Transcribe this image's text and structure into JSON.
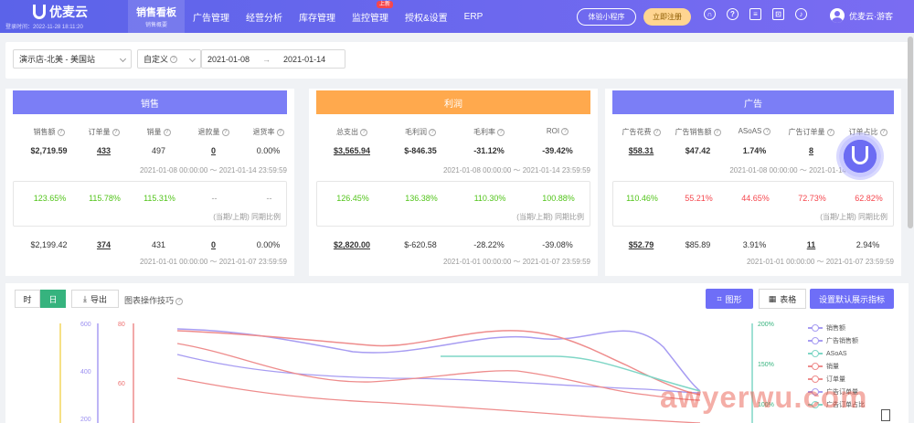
{
  "app": {
    "brand": "优麦云",
    "login_time": "登录时间：2022-11-28 18:11:20"
  },
  "nav": [
    {
      "label": "销售看板",
      "sub": "销售概要",
      "active": true
    },
    {
      "label": "广告管理"
    },
    {
      "label": "经营分析"
    },
    {
      "label": "库存管理"
    },
    {
      "label": "监控管理",
      "badge": "上新"
    },
    {
      "label": "授权&设置"
    },
    {
      "label": "ERP"
    }
  ],
  "header": {
    "mini_program": "体验小程序",
    "register": "立即注册",
    "user": "优麦云·游客"
  },
  "filter": {
    "store": "演示店-北美 - 美国站",
    "mode": "自定义",
    "start": "2021-01-08",
    "arrow": "→",
    "end": "2021-01-14"
  },
  "sales": {
    "title": "销售",
    "color": "#7b7ef6",
    "labels": [
      "销售额",
      "订单量",
      "销量",
      "退款量",
      "退货率"
    ],
    "current": [
      "$2,719.59",
      "433",
      "497",
      "0",
      "0.00%"
    ],
    "current_range": "2021-01-08 00:00:00 ～ 2021-01-14 23:59:59",
    "compare": [
      "123.65%",
      "115.78%",
      "115.31%",
      "--",
      "--"
    ],
    "compare_note": "(当期/上期) 同期比例",
    "previous": [
      "$2,199.42",
      "374",
      "431",
      "0",
      "0.00%"
    ],
    "previous_range": "2021-01-01 00:00:00 ～ 2021-01-07 23:59:59"
  },
  "profit": {
    "title": "利润",
    "color": "#ffa94d",
    "labels": [
      "总支出",
      "毛利润",
      "毛利率",
      "ROI"
    ],
    "current": [
      "$3,565.94",
      "$-846.35",
      "-31.12%",
      "-39.42%"
    ],
    "current_range": "2021-01-08 00:00:00 ～ 2021-01-14 23:59:59",
    "compare": [
      "126.45%",
      "136.38%",
      "110.30%",
      "100.88%"
    ],
    "compare_note": "(当期/上期) 同期比例",
    "previous": [
      "$2,820.00",
      "$-620.58",
      "-28.22%",
      "-39.08%"
    ],
    "previous_range": "2021-01-01 00:00:00 ～ 2021-01-07 23:59:59"
  },
  "ads": {
    "title": "广告",
    "color": "#7b7ef6",
    "labels": [
      "广告花费",
      "广告销售额",
      "ASoAS",
      "广告订单量",
      "订单占比"
    ],
    "current": [
      "$58.31",
      "$47.42",
      "1.74%",
      "8",
      ""
    ],
    "current_range": "2021-01-08 00:00:00 ～ 2021-01-14",
    "compare": [
      "110.46%",
      "55.21%",
      "44.65%",
      "72.73%",
      "62.82%"
    ],
    "compare_note": "(当期/上期) 同期比例",
    "previous": [
      "$52.79",
      "$85.89",
      "3.91%",
      "11",
      "2.94%"
    ],
    "previous_range": "2021-01-01 00:00:00 ～ 2021-01-07 23:59:59"
  },
  "toolbar": {
    "hour": "时",
    "day": "日",
    "export": "导出",
    "tips": "图表操作技巧",
    "chart": "图形",
    "table": "表格",
    "default": "设置默认展示指标"
  },
  "chart_data": {
    "type": "line",
    "y_left_outer": {
      "ticks": [
        "600",
        "400",
        "200"
      ]
    },
    "y_left_inner": {
      "ticks": [
        "80",
        "60"
      ]
    },
    "y_right": {
      "ticks": [
        "200%",
        "150%",
        "100%"
      ]
    },
    "legend_placement": "right",
    "series": [
      {
        "name": "销售额",
        "color": "#a79cf2"
      },
      {
        "name": "广告销售额",
        "color": "#a79cf2"
      },
      {
        "name": "ASoAS",
        "color": "#7fd6c6"
      },
      {
        "name": "销量",
        "color": "#ee8c8c"
      },
      {
        "name": "订单量",
        "color": "#ee8c8c"
      },
      {
        "name": "广告订单量",
        "color": "#a79cf2"
      },
      {
        "name": "广告订单占比",
        "color": "#7fd6c6"
      }
    ]
  },
  "watermark": "awyerwu.com"
}
